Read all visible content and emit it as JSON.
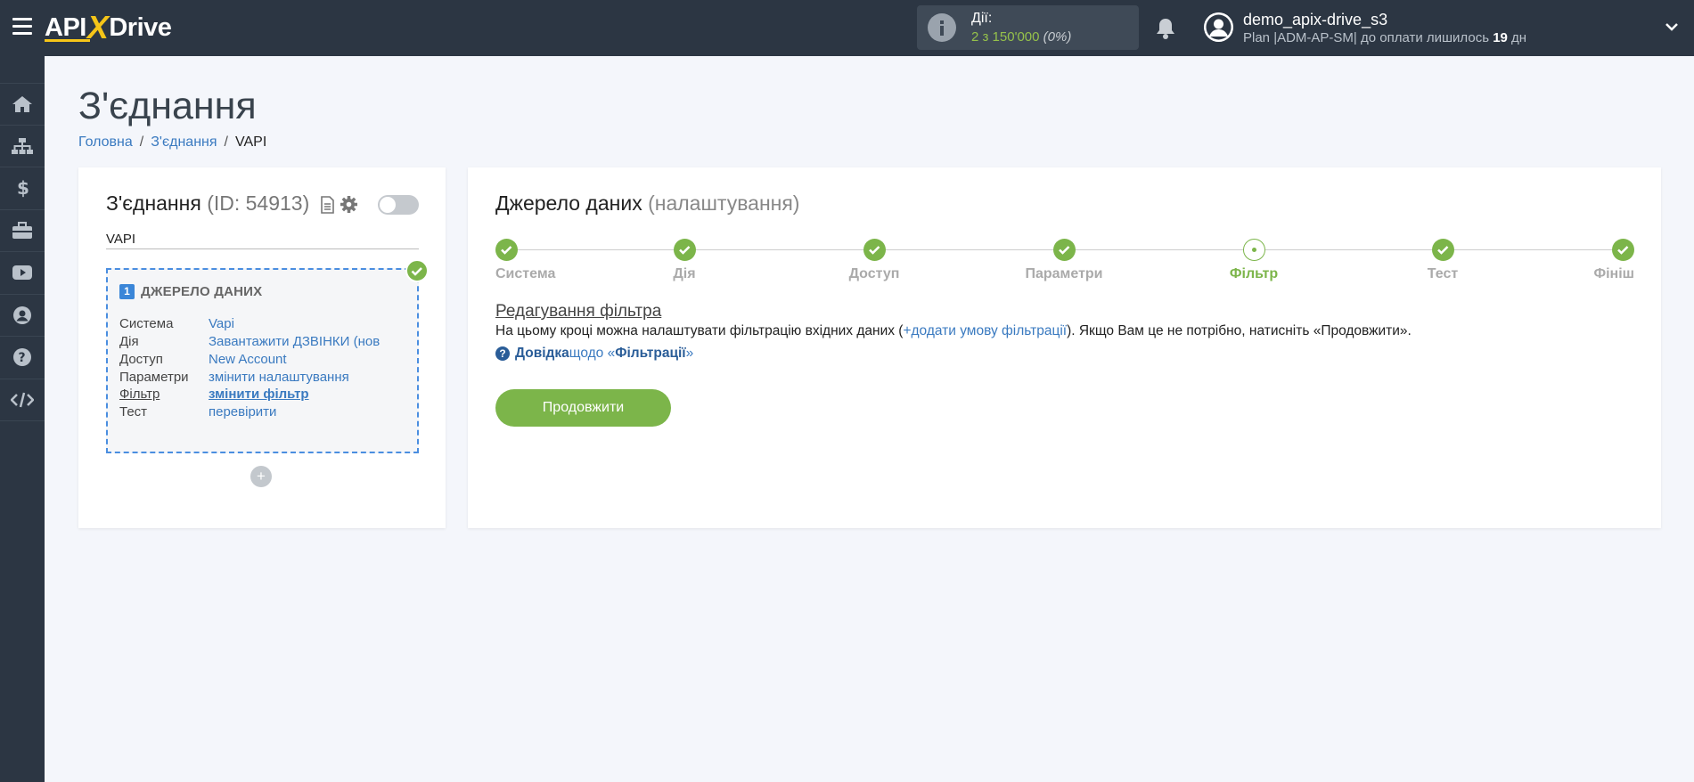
{
  "header": {
    "logo": {
      "api": "API",
      "x": "X",
      "drive": "Drive"
    },
    "actions": {
      "label": "Дії:",
      "count": "2 з 150'000",
      "percent": "(0%)"
    },
    "user": {
      "name": "demo_apix-drive_s3",
      "plan_prefix": "Plan |ADM-AP-SM| до оплати лишилось ",
      "days": "19",
      "days_suffix": " дн"
    }
  },
  "sidebar": {
    "items": [
      {
        "icon": "home-icon"
      },
      {
        "icon": "sitemap-icon"
      },
      {
        "icon": "dollar-icon"
      },
      {
        "icon": "briefcase-icon"
      },
      {
        "icon": "youtube-icon"
      },
      {
        "icon": "user-circle-icon"
      },
      {
        "icon": "question-icon"
      },
      {
        "icon": "code-icon"
      }
    ]
  },
  "page": {
    "title": "З'єднання",
    "breadcrumb": [
      "Головна",
      "З'єднання",
      "VAPI"
    ]
  },
  "connection": {
    "title": "З'єднання",
    "id_text": "(ID: 54913)",
    "name": "VAPI",
    "source": {
      "number": "1",
      "heading": "ДЖЕРЕЛО ДАНИХ",
      "rows": [
        {
          "key": "Система",
          "value": "Vapi"
        },
        {
          "key": "Дія",
          "value": "Завантажити ДЗВІНКИ (нов"
        },
        {
          "key": "Доступ",
          "value": "New Account"
        },
        {
          "key": "Параметри",
          "value": "змінити налаштування"
        },
        {
          "key": "Фільтр",
          "value": "змінити фільтр"
        },
        {
          "key": "Тест",
          "value": "перевірити"
        }
      ]
    },
    "add_symbol": "+"
  },
  "datasource": {
    "title": "Джерело даних",
    "subtitle": "(налаштування)",
    "steps": [
      {
        "label": "Система",
        "state": "done"
      },
      {
        "label": "Дія",
        "state": "done"
      },
      {
        "label": "Доступ",
        "state": "done"
      },
      {
        "label": "Параметри",
        "state": "done"
      },
      {
        "label": "Фільтр",
        "state": "current"
      },
      {
        "label": "Тест",
        "state": "done"
      },
      {
        "label": "Фініш",
        "state": "done"
      }
    ],
    "filter": {
      "title": "Редагування фільтра",
      "desc_before": "На цьому кроці можна налаштувати фільтрацію вхідних даних (",
      "add_link": "+додати умову фільтрації",
      "desc_after": "). Якщо Вам це не потрібно, натисніть «Продовжити».",
      "help_bold": "Довідка",
      "help_text": " щодо «",
      "help_bold2": "Фільтрації",
      "help_end": "»"
    },
    "continue_label": "Продовжити"
  },
  "colors": {
    "topbar": "#2c3643",
    "accent_green": "#7cb54a",
    "link_blue": "#3a7ac0",
    "logo_yellow": "#f5c518"
  }
}
